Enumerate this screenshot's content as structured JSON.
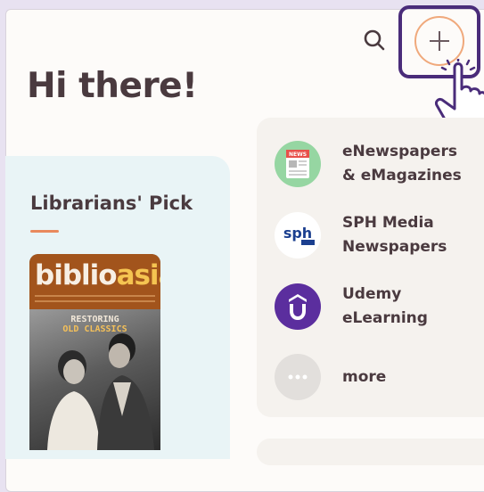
{
  "header": {
    "greeting": "Hi there!",
    "search_icon": "search-icon",
    "add_icon": "plus-icon"
  },
  "librarians_pick": {
    "title": "Librarians' Pick",
    "cover": {
      "logo_part1": "biblio",
      "logo_part2": "asia",
      "headline_1": "RESTORING",
      "headline_2": "OLD CLASSICS"
    }
  },
  "quick_links": [
    {
      "label": "eNewspapers\n& eMagazines",
      "icon": "newspaper-icon",
      "badge": "NEWS"
    },
    {
      "label": "SPH Media\nNewspapers",
      "icon": "sph-logo-icon",
      "badge": "sph"
    },
    {
      "label": "Udemy\neLearning",
      "icon": "udemy-icon",
      "badge": "Û"
    },
    {
      "label": "more",
      "icon": "more-dots-icon",
      "badge": "•••"
    }
  ],
  "colors": {
    "accent": "#f0a97c",
    "highlight": "#4a2c7a",
    "text": "#4a3a3f",
    "pick_panel": "#e9f4f6",
    "links_panel": "#f5f2ee"
  }
}
